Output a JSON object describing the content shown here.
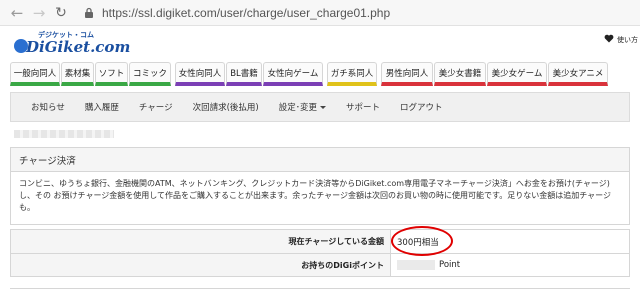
{
  "browser": {
    "url": "https://ssl.digiket.com/user/charge/user_charge01.php"
  },
  "logo": {
    "kana": "デジケット・コム",
    "name": "DiGiket.com"
  },
  "favorites": {
    "label": "使い方"
  },
  "categories": [
    {
      "label": "一般向同人",
      "color": "#3aa845"
    },
    {
      "label": "素材集",
      "color": "#3aa845"
    },
    {
      "label": "ソフト",
      "color": "#3aa845"
    },
    {
      "label": "コミック",
      "color": "#3aa845"
    },
    {
      "label": "女性向同人",
      "color": "#7b3fb5"
    },
    {
      "label": "BL書籍",
      "color": "#7b3fb5"
    },
    {
      "label": "女性向ゲーム",
      "color": "#7b3fb5"
    },
    {
      "label": "ガチ系同人",
      "color": "#e0c21a"
    },
    {
      "label": "男性向同人",
      "color": "#d9323b"
    },
    {
      "label": "美少女書籍",
      "color": "#d9323b"
    },
    {
      "label": "美少女ゲーム",
      "color": "#d9323b"
    },
    {
      "label": "美少女アニメ",
      "color": "#d9323b"
    }
  ],
  "subnav": {
    "items": [
      "お知らせ",
      "購入履歴",
      "チャージ",
      "次回請求(後払用)",
      "設定･変更",
      "サポート",
      "ログアウト"
    ]
  },
  "charge": {
    "title": "チャージ決済",
    "description": "コンビニ、ゆうちょ銀行、金融機関のATM、ネットバンキング、クレジットカード決済等からDiGiket.com専用電子マネーチャージ決済」へお金をお預け(チャージ)し、その お預けチャージ金額を使用して作品をご購入することが出来ます。余ったチャージ金額は次回のお買い物の時に使用可能です。足りない金額は追加チャージも。"
  },
  "table": {
    "rows": [
      {
        "label": "現在チャージしている金額",
        "value": "300円相当"
      },
      {
        "label": "お持ちのDiGiポイント",
        "value": "Point"
      }
    ]
  }
}
